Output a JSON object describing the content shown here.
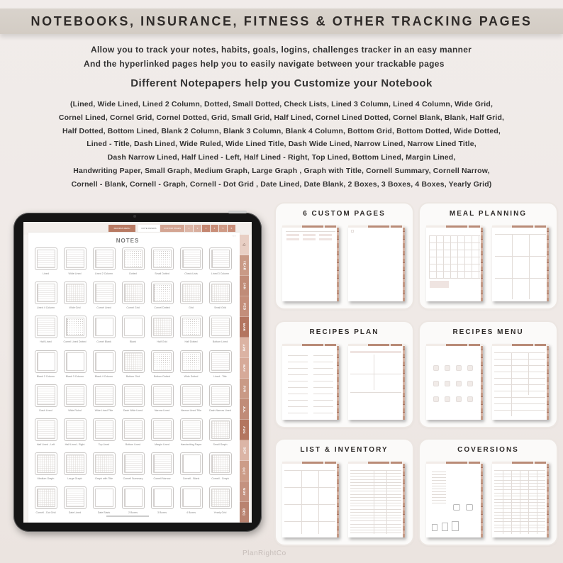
{
  "banner": {
    "title": "NOTEBOOKS, INSURANCE, FITNESS & OTHER TRACKING PAGES"
  },
  "intro": {
    "line1": "Allow you to track your notes, habits, goals, logins, challenges tracker in an easy manner",
    "line2": "And the hyperlinked pages help you to easily navigate between your trackable pages"
  },
  "notepapers": {
    "heading": "Different Notepapers help you Customize your Notebook",
    "lines": [
      "(Lined, Wide Lined, Lined 2 Column, Dotted, Small Dotted, Check Lists, Lined 3 Column, Lined 4 Column, Wide Grid,",
      "Cornel Lined, Cornel Grid, Cornel Dotted, Grid, Small Grid, Half Lined, Cornel Lined Dotted, Cornel Blank, Blank, Half Grid,",
      "Half Dotted, Bottom Lined, Blank 2 Column, Blank 3 Column, Blank 4 Column, Bottom Grid, Bottom Dotted, Wide Dotted,",
      "Lined - Title, Dash Lined, Wide Ruled, Wide Lined Title, Dash Wide Lined, Narrow Lined, Narrow Lined Title,",
      "Dash Narrow Lined, Half Lined - Left, Half Lined - Right, Top Lined, Bottom Lined, Margin Lined,",
      "Handwriting Paper, Small Graph, Medium Graph, Large Graph , Graph with Title,  Cornell Summary, Cornell Narrow,",
      "Cornell - Blank, Cornell - Graph, Cornell - Dot Grid , Date Lined, Date Blank, 2 Boxes, 3 Boxes, 4 Boxes, Yearly Grid)"
    ]
  },
  "tablet": {
    "top_tabs": [
      {
        "label": "RECIPES MENU",
        "color": "#b87a63"
      },
      {
        "label": "NOTE PAPERS",
        "color": "#ffffff",
        "active": true
      },
      {
        "label": "CUSTOM PAGES",
        "color": "#d4a593"
      },
      {
        "label": "1",
        "color": "#dcb5a6"
      },
      {
        "label": "2",
        "color": "#d8ae9e"
      },
      {
        "label": "3",
        "color": "#c48670"
      },
      {
        "label": "4",
        "color": "#c98e78"
      },
      {
        "label": "5",
        "color": "#cf9a85"
      },
      {
        "label": "6",
        "color": "#c98f7a"
      }
    ],
    "page_nav": "‹  ›",
    "page_title": "NOTES",
    "side_tabs": [
      {
        "label": "⌂",
        "color": "#e8cfc4",
        "home": true
      },
      {
        "label": "YEAR",
        "color": "#c99a86"
      },
      {
        "label": "JAN",
        "color": "#c08c78"
      },
      {
        "label": "FEB",
        "color": "#c38e7a"
      },
      {
        "label": "MAR",
        "color": "#b37560"
      },
      {
        "label": "APR",
        "color": "#dbb3a3"
      },
      {
        "label": "MAY",
        "color": "#d6aa99"
      },
      {
        "label": "JUN",
        "color": "#c99a86"
      },
      {
        "label": "JUL",
        "color": "#c08c78"
      },
      {
        "label": "AUG",
        "color": "#b3765f"
      },
      {
        "label": "SEP",
        "color": "#dbb5a6"
      },
      {
        "label": "OCT",
        "color": "#cc9c88"
      },
      {
        "label": "NOV",
        "color": "#c49280"
      },
      {
        "label": "DEC",
        "color": "#b98370"
      }
    ],
    "papers": [
      "Lined",
      "Wide Lined",
      "Lined 2 Column",
      "Dotted",
      "Small Dotted",
      "Check Lists",
      "Lined 3 Column",
      "Lined 4 Column",
      "Wide Grid",
      "Cornel Lined",
      "Cornel Grid",
      "Cornel Dotted",
      "Grid",
      "Small Grid",
      "Half Lined",
      "Cornel Lined Dotted",
      "Cornel Blank",
      "Blank",
      "Half Grid",
      "Half Dotted",
      "Bottom Lined",
      "Blank 2 Column",
      "Blank 3 Column",
      "Blank 4 Column",
      "Bottom Grid",
      "Bottom Dotted",
      "Wide Dotted",
      "Lined - Title",
      "Dash Lined",
      "Wide Ruled",
      "Wide Lined Title",
      "Dash Wide Lined",
      "Narrow Lined",
      "Narrow Lined Title",
      "Dash Narrow Lined",
      "Half Lined - Left",
      "Half Lined - Right",
      "Top Lined",
      "Bottom Lined",
      "Margin Lined",
      "Handwriting Paper",
      "Small Graph",
      "Medium Graph",
      "Large Graph",
      "Graph with Title",
      "Cornell Summary",
      "Cornell Narrow",
      "Cornell - Blank",
      "Cornell - Graph",
      "Cornell - Dot Grid",
      "Date Lined",
      "Date Blank",
      "2 Boxes",
      "3 Boxes",
      "4 Boxes",
      "Yearly Grid"
    ]
  },
  "cards": [
    {
      "title": "6 CUSTOM PAGES",
      "kind": "custom"
    },
    {
      "title": "MEAL PLANNING",
      "kind": "meal"
    },
    {
      "title": "RECIPES PLAN",
      "kind": "recipes-plan"
    },
    {
      "title": "RECIPES MENU",
      "kind": "recipes-menu"
    },
    {
      "title": "LIST & INVENTORY",
      "kind": "list"
    },
    {
      "title": "COVERSIONS",
      "kind": "conversions"
    }
  ],
  "watermark": "PlanRightCo",
  "colors": {
    "accent": "#b87a63",
    "tablet_frame": "#151515",
    "background": "#efe9e6",
    "banner": "#d6cfc7"
  }
}
